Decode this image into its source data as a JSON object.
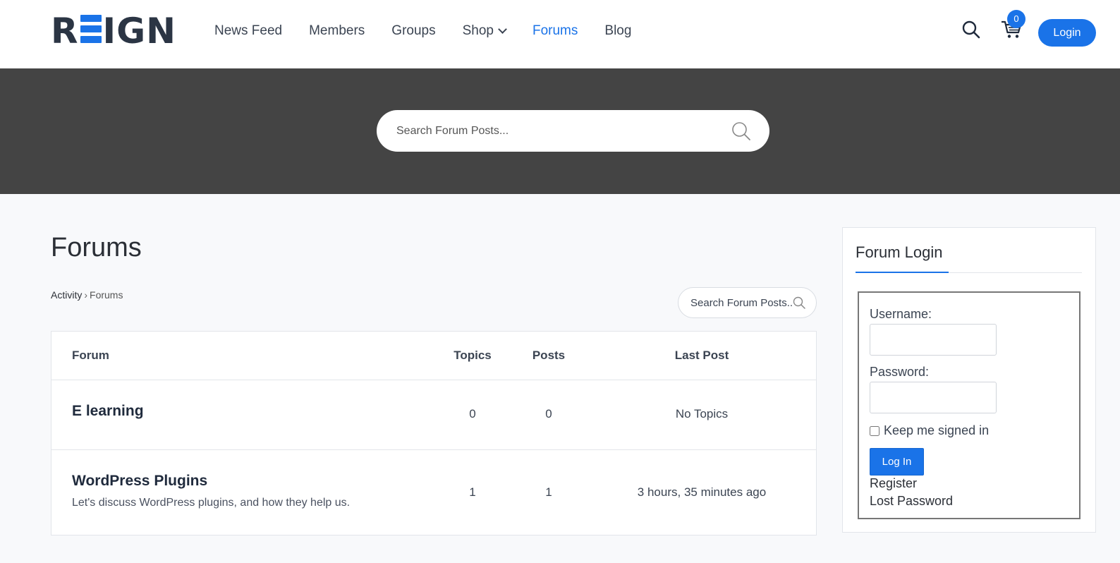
{
  "header": {
    "logo_left": "R",
    "logo_right": "IGN",
    "nav": [
      {
        "label": "News Feed"
      },
      {
        "label": "Members"
      },
      {
        "label": "Groups"
      },
      {
        "label": "Shop"
      },
      {
        "label": "Forums"
      },
      {
        "label": "Blog"
      }
    ],
    "cart_count": "0",
    "login_label": "Login",
    "accent_color": "#1a73e8"
  },
  "banner": {
    "search_placeholder": "Search Forum Posts..."
  },
  "main": {
    "title": "Forums",
    "breadcrumb": {
      "root": "Activity",
      "separator": "›",
      "current": "Forums"
    },
    "search_placeholder": "Search Forum Posts...",
    "table": {
      "headers": {
        "forum": "Forum",
        "topics": "Topics",
        "posts": "Posts",
        "last_post": "Last Post"
      },
      "rows": [
        {
          "name": "E learning",
          "description": "",
          "topics": "0",
          "posts": "0",
          "last_post": "No Topics"
        },
        {
          "name": "WordPress Plugins",
          "description": "Let's discuss WordPress plugins, and how they help us.",
          "topics": "1",
          "posts": "1",
          "last_post": "3 hours, 35 minutes ago"
        }
      ]
    }
  },
  "sidebar": {
    "title": "Forum Login",
    "username_label": "Username:",
    "password_label": "Password:",
    "remember_label": "Keep me signed in",
    "login_button": "Log In",
    "register_link": "Register",
    "lost_password_link": "Lost Password"
  }
}
